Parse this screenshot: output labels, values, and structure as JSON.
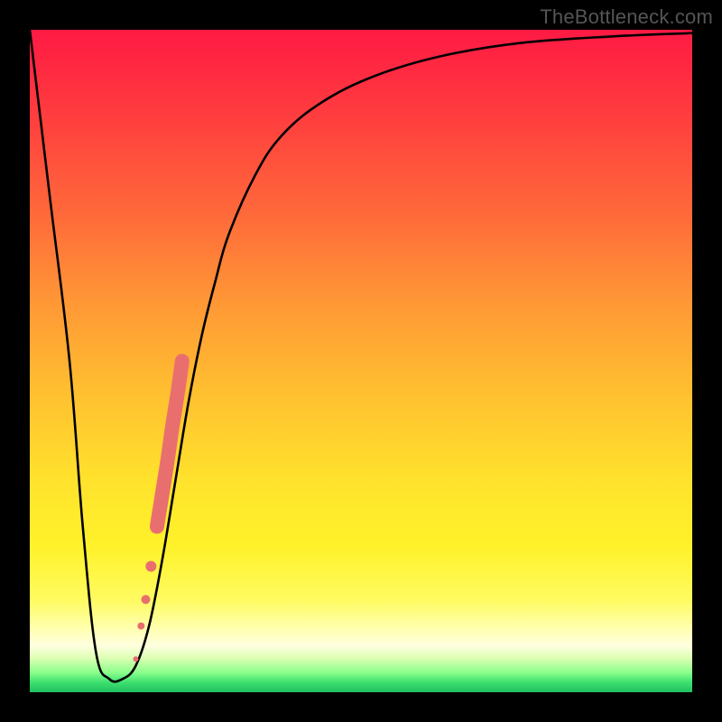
{
  "watermark": "TheBottleneck.com",
  "chart_data": {
    "type": "line",
    "title": "",
    "xlabel": "",
    "ylabel": "",
    "xlim": [
      0,
      100
    ],
    "ylim": [
      0,
      100
    ],
    "curve": {
      "x": [
        0,
        3,
        6,
        8,
        10,
        12,
        14,
        16,
        18,
        20,
        22,
        24,
        26,
        28,
        30,
        34,
        38,
        44,
        52,
        62,
        74,
        88,
        100
      ],
      "y": [
        100,
        75,
        50,
        25,
        6,
        2,
        2,
        4,
        10,
        20,
        32,
        44,
        54,
        62,
        69,
        78,
        84,
        89,
        93,
        96,
        98,
        99,
        99.5
      ]
    },
    "marker_series": {
      "name": "highlight-band",
      "color": "#e96f6f",
      "points": [
        {
          "x": 16.0,
          "y": 5
        },
        {
          "x": 16.8,
          "y": 10
        },
        {
          "x": 17.5,
          "y": 14
        },
        {
          "x": 18.3,
          "y": 19
        },
        {
          "x": 19.2,
          "y": 25
        },
        {
          "x": 20.0,
          "y": 30
        },
        {
          "x": 20.8,
          "y": 35
        },
        {
          "x": 21.5,
          "y": 40
        },
        {
          "x": 22.3,
          "y": 45
        },
        {
          "x": 23.0,
          "y": 50
        }
      ]
    }
  }
}
